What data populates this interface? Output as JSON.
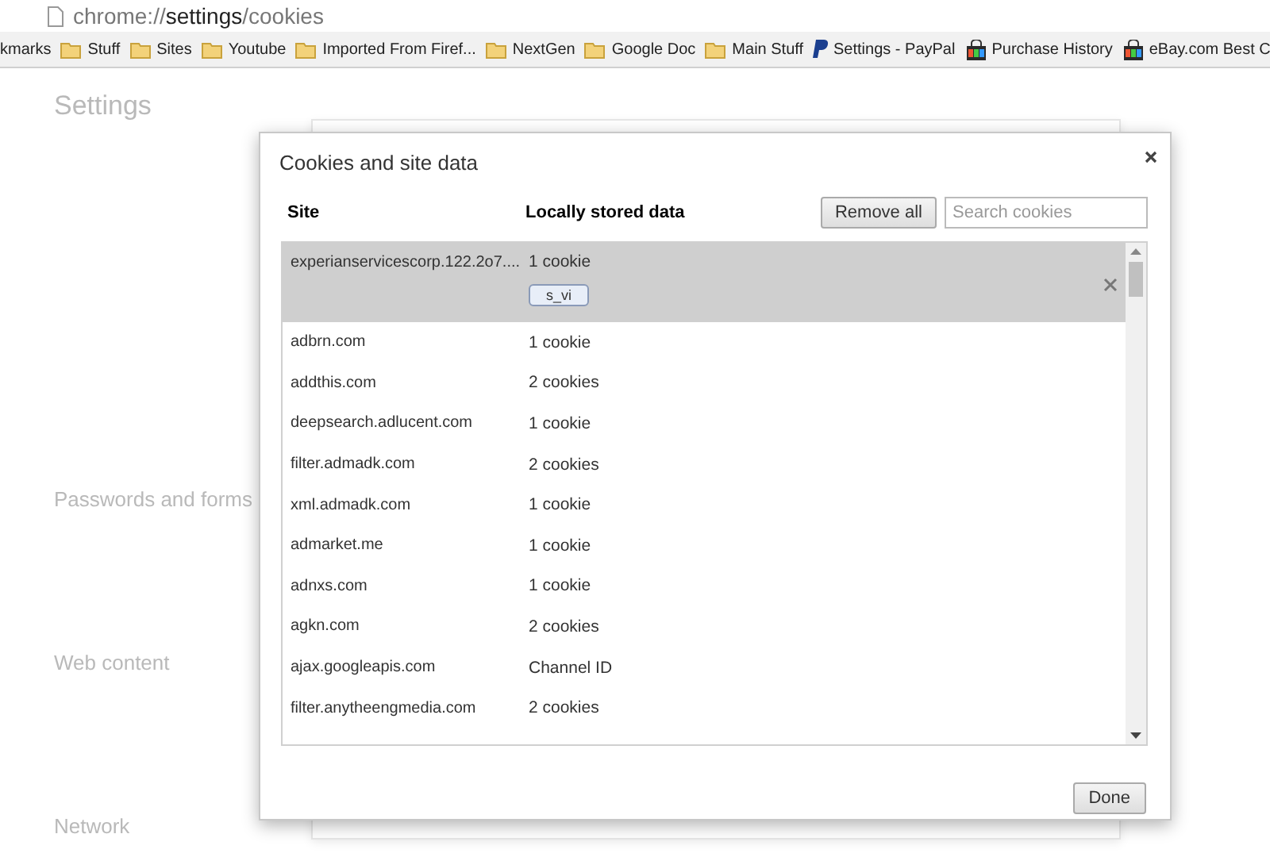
{
  "address_bar": {
    "scheme": "chrome://",
    "host": "settings",
    "path": "/cookies"
  },
  "bookmarks": [
    {
      "label": "kmarks",
      "kind": "plain"
    },
    {
      "label": "Stuff",
      "kind": "folder"
    },
    {
      "label": "Sites",
      "kind": "folder"
    },
    {
      "label": "Youtube",
      "kind": "folder"
    },
    {
      "label": "Imported From Firef...",
      "kind": "folder"
    },
    {
      "label": "NextGen",
      "kind": "folder"
    },
    {
      "label": "Google Doc",
      "kind": "folder"
    },
    {
      "label": "Main Stuff",
      "kind": "folder"
    },
    {
      "label": "Settings - PayPal",
      "kind": "paypal"
    },
    {
      "label": "Purchase History",
      "kind": "shop"
    },
    {
      "label": "eBay.com Best C",
      "kind": "shop"
    }
  ],
  "background": {
    "title": "Settings",
    "sections": [
      "Passwords and forms",
      "Web content",
      "Network"
    ]
  },
  "dialog": {
    "title": "Cookies and site data",
    "columns": [
      "Site",
      "Locally stored data"
    ],
    "remove_all": "Remove all",
    "search": {
      "placeholder": "Search cookies"
    },
    "rows": [
      {
        "site": "experianservicescorp.122.2o7....",
        "data": "1 cookie",
        "selected": true,
        "items": [
          "s_vi"
        ]
      },
      {
        "site": "adbrn.com",
        "data": "1 cookie",
        "selected": false
      },
      {
        "site": "addthis.com",
        "data": "2 cookies",
        "selected": false
      },
      {
        "site": "deepsearch.adlucent.com",
        "data": "1 cookie",
        "selected": false
      },
      {
        "site": "filter.admadk.com",
        "data": "2 cookies",
        "selected": false
      },
      {
        "site": "xml.admadk.com",
        "data": "1 cookie",
        "selected": false
      },
      {
        "site": "admarket.me",
        "data": "1 cookie",
        "selected": false
      },
      {
        "site": "adnxs.com",
        "data": "1 cookie",
        "selected": false
      },
      {
        "site": "agkn.com",
        "data": "2 cookies",
        "selected": false
      },
      {
        "site": "ajax.googleapis.com",
        "data": "Channel ID",
        "selected": false
      },
      {
        "site": "filter.anytheengmedia.com",
        "data": "2 cookies",
        "selected": false
      }
    ],
    "done": "Done"
  }
}
